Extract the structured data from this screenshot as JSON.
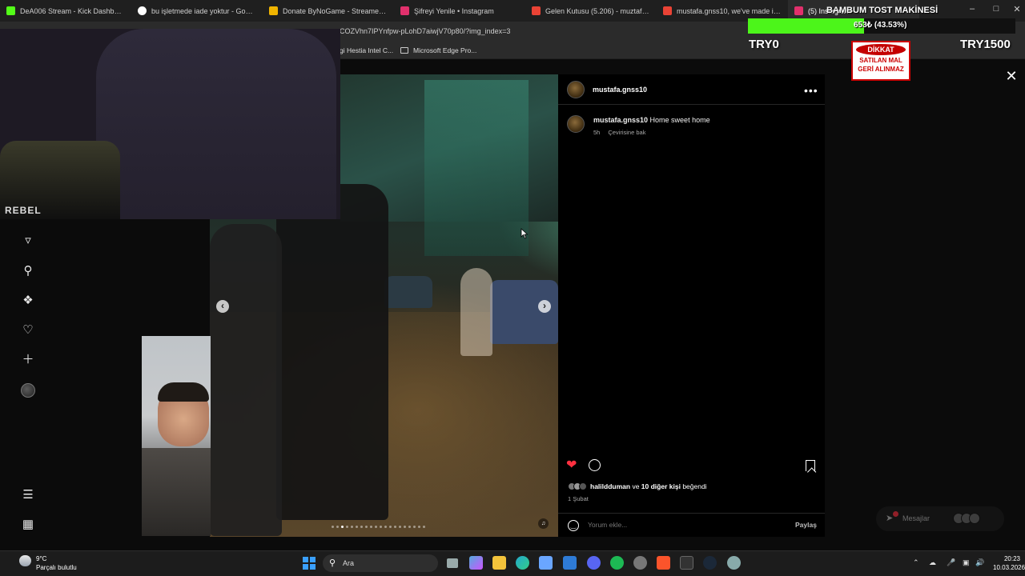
{
  "tabs": [
    {
      "label": "DeA006 Stream - Kick Dashboard",
      "icon": "kick-icon",
      "color": "#53fc18"
    },
    {
      "label": "bu işletmede iade yoktur - Google'da",
      "icon": "google-icon",
      "color": "#ffffff"
    },
    {
      "label": "Donate ByNoGame - Streamer Settings",
      "icon": "bynogame-icon",
      "color": "#f0b400"
    },
    {
      "label": "Şifreyi Yenile • Instagram",
      "icon": "instagram-icon",
      "color": "#e1306c"
    },
    {
      "label": "Gelen Kutusu (5.206) - muztafagune",
      "icon": "gmail-icon",
      "color": "#ea4335"
    },
    {
      "label": "mustafa.gnss10, we've made it easy",
      "icon": "gmail-icon",
      "color": "#ea4335"
    },
    {
      "label": "(5) Instagram",
      "icon": "instagram-icon",
      "color": "#e1306c"
    }
  ],
  "url": "COZVhn7IPYnfpw-pLohD7aiwjV70p80/?img_index=3",
  "bookmarks": [
    {
      "label": "gi Hestia Intel C..."
    },
    {
      "label": "Microsoft Edge Pro..."
    }
  ],
  "post": {
    "username": "mustafa.gnss10",
    "caption_user": "mustafa.gnss10",
    "caption_text": "Home sweet home",
    "time": "5h",
    "translate": "Çevirisine bak",
    "liked_by_user": "halildduman",
    "liked_by_connector": "ve",
    "liked_by_others": "10 diğer kişi",
    "liked_by_suffix": "beğendi",
    "date": "1 Şubat",
    "comment_placeholder": "Yorum ekle...",
    "share_label": "Paylaş",
    "slide_count": 20,
    "active_slide": 3
  },
  "donation": {
    "title": "BAMBUM TOST MAKİNESİ",
    "progress_label": "653₺ (43.53%)",
    "progress": 0.4353,
    "min_label": "TRY0",
    "max_label": "TRY1500",
    "fill_color": "#4cf51a",
    "sign_header": "DİKKAT",
    "sign_line1": "SATILAN MAL",
    "sign_line2": "GERİ ALINMAZ"
  },
  "messages": {
    "label": "Mesajlar"
  },
  "webcam": {
    "shirt_text": "REBEL"
  },
  "taskbar": {
    "weather_temp": "9°C",
    "weather_desc": "Parçalı bulutlu",
    "search_placeholder": "Ara",
    "time": "20:23",
    "date": "10.03.2026"
  }
}
